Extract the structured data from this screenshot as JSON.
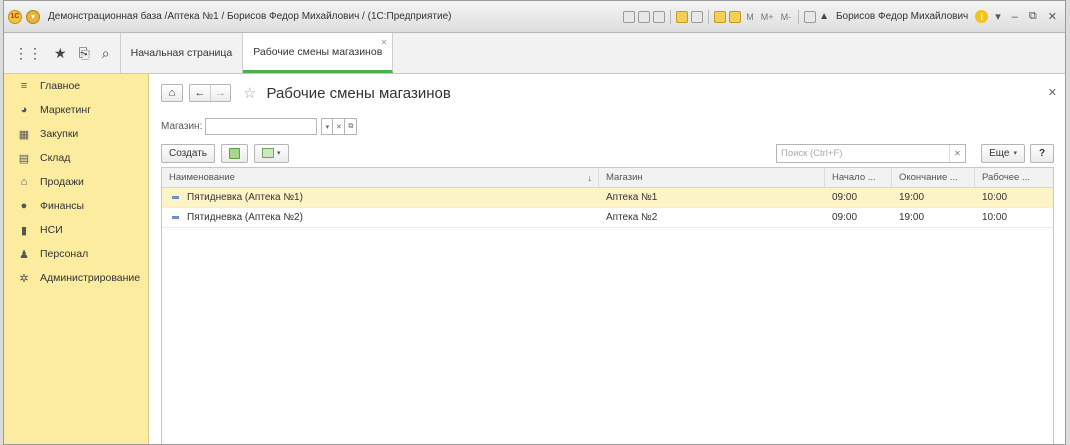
{
  "window": {
    "title": "Демонстрационная база /Аптека №1 / Борисов Федор Михайлович / (1С:Предприятие)",
    "user": "Борисов Федор Михайлович",
    "m_labels": [
      "M",
      "M+",
      "M-"
    ]
  },
  "tabs": {
    "home": "Начальная страница",
    "active": "Рабочие смены магазинов"
  },
  "sidebar": {
    "items": [
      {
        "label": "Главное",
        "icon": "menu-lines-icon"
      },
      {
        "label": "Маркетинг",
        "icon": "pie-chart-icon"
      },
      {
        "label": "Закупки",
        "icon": "cart-icon"
      },
      {
        "label": "Склад",
        "icon": "warehouse-icon"
      },
      {
        "label": "Продажи",
        "icon": "shop-icon"
      },
      {
        "label": "Финансы",
        "icon": "coin-icon"
      },
      {
        "label": "НСИ",
        "icon": "book-icon"
      },
      {
        "label": "Персонал",
        "icon": "person-icon"
      },
      {
        "label": "Администрирование",
        "icon": "gear-icon"
      }
    ]
  },
  "page": {
    "title": "Рабочие смены магазинов",
    "filter_label": "Магазин:",
    "filter_value": "",
    "create_button": "Создать",
    "search_placeholder": "Поиск (Ctrl+F)",
    "more_button": "Еще",
    "help_button": "?"
  },
  "table": {
    "columns": [
      "Наименование",
      "Магазин",
      "Начало ...",
      "Окончание ...",
      "Рабочее ..."
    ],
    "rows": [
      {
        "name": "Пятидневка (Аптека №1)",
        "store": "Аптека №1",
        "start": "09:00",
        "end": "19:00",
        "work": "10:00",
        "selected": true
      },
      {
        "name": "Пятидневка (Аптека №2)",
        "store": "Аптека №2",
        "start": "09:00",
        "end": "19:00",
        "work": "10:00",
        "selected": false
      }
    ]
  },
  "colors": {
    "sidebar_bg": "#fbeca0",
    "selected_row": "#fcf3c7",
    "active_tab_underline": "#4caf50"
  }
}
